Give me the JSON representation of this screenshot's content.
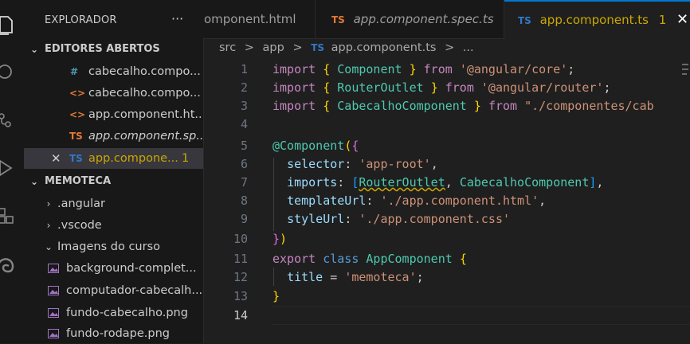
{
  "activity_bar": [
    "files-icon",
    "search-icon",
    "source-control-icon",
    "run-debug-icon",
    "extensions-icon",
    "edge-icon"
  ],
  "sidebar": {
    "title": "EXPLORADOR",
    "more": "···",
    "open_editors_label": "EDITORES ABERTOS",
    "open_editors": [
      {
        "icon": "#",
        "name": "cabecalho.compo..."
      },
      {
        "icon": "<>",
        "name": "cabecalho.compo..."
      },
      {
        "icon": "<>",
        "name": "app.component.ht..."
      },
      {
        "icon": "TS",
        "name": "app.component.sp..."
      },
      {
        "icon": "TS",
        "name": "app.compone...",
        "badge": "1",
        "close": "✕"
      }
    ],
    "project_label": "MEMOTECA",
    "tree": [
      {
        "name": ".angular"
      },
      {
        "name": ".vscode"
      },
      {
        "name": "Imagens do curso"
      },
      {
        "name": "background-complet..."
      },
      {
        "name": "computador-cabecalh..."
      },
      {
        "name": "fundo-cabecalho.png"
      },
      {
        "name": "fundo-rodape.png"
      }
    ]
  },
  "tabs": [
    {
      "name": "omponent.html"
    },
    {
      "icon": "TS",
      "name": "app.component.spec.ts"
    },
    {
      "icon": "TS",
      "name": "app.component.ts",
      "badge": "1",
      "close": "✕"
    }
  ],
  "breadcrumb": [
    "src",
    ">",
    "app",
    ">",
    "TS",
    "app.component.ts",
    ">",
    "..."
  ],
  "editor": {
    "line_numbers": [
      "1",
      "2",
      "3",
      "4",
      "5",
      "6",
      "7",
      "8",
      "9",
      "10",
      "11",
      "12",
      "13",
      "14"
    ],
    "tokens": {
      "import": "import",
      "from": "from",
      "export": "export",
      "class": "class",
      "lb": "{",
      "rb": "}",
      "lp": "(",
      "rp": ")",
      "lsq": "[",
      "rsq": "]",
      "component": "Component",
      "routeroutlet": "RouterOutlet",
      "cabecalhocomponent": "CabecalhoComponent",
      "s_core": "'@angular/core'",
      "s_router": "'@angular/router'",
      "s_cab": "\"./componentes/cab",
      "semi": ";",
      "at": "@",
      "selector": "selector",
      "imports": "imports",
      "templateUrl": "templateUrl",
      "styleUrl": "styleUrl",
      "s_root": "'app-root'",
      "s_html": "'./app.component.html'",
      "s_css": "'./app.component.css'",
      "appcomponent": "AppComponent",
      "title": "title",
      "eq": "=",
      "s_memo": "'memoteca'",
      "colon": ":",
      "comma": ","
    }
  }
}
